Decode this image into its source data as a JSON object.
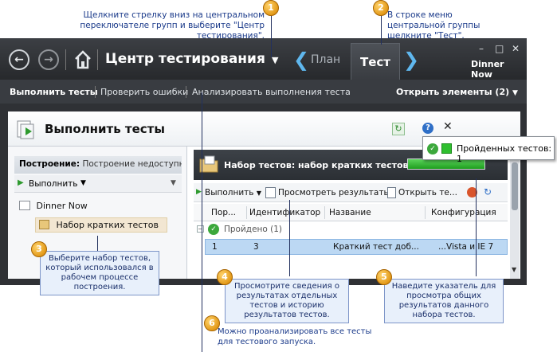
{
  "callouts": [
    {
      "num": "1",
      "text": "Щелкните стрелку вниз на центральном переключателе групп и выберите \"Центр тестирования\"."
    },
    {
      "num": "2",
      "text": "В строке меню центральной группы щелкните \"Тест\"."
    },
    {
      "num": "3",
      "text": "Выберите набор тестов, который использовался в рабочем процессе построения."
    },
    {
      "num": "4",
      "text": "Просмотрите сведения о результатах отдельных тестов и историю результатов тестов."
    },
    {
      "num": "5",
      "text": "Наведите указатель для просмотра общих результатов данного набора тестов."
    },
    {
      "num": "6",
      "text": "Можно проанализировать все тесты для тестового запуска."
    }
  ],
  "titlebar": {
    "title": "Центр тестирования",
    "tab_plan": "План",
    "tab_test": "Тест",
    "project": "Dinner Now",
    "minimize": "–",
    "restore": "□",
    "close": "✕"
  },
  "menubar": {
    "run_tests": "Выполнить тесты",
    "verify_bugs": "Проверить ошибки",
    "analyze_runs": "Анализировать выполнения теста",
    "open_items": "Открыть элементы (2)"
  },
  "page": {
    "title": "Выполнить тесты"
  },
  "left": {
    "build_label": "Построение:",
    "build_value": "Построение недоступно",
    "run_label": "Выполнить",
    "tree_root": "Dinner Now",
    "tree_child": "Набор кратких тестов"
  },
  "right": {
    "suite_title": "Набор тестов: набор кратких тестов",
    "toolbar": {
      "run": "Выполнить",
      "view_results": "Просмотреть результаты",
      "open_test": "Открыть те..."
    },
    "columns": [
      "Пор...",
      "Идентификатор",
      "Название",
      "Конфигурация"
    ],
    "group_label": "Пройдено (1)",
    "row": {
      "order": "1",
      "id": "3",
      "name": "Краткий тест доб...",
      "config": "...Vista и IE 7"
    }
  },
  "tooltip": {
    "text": "Пройденных тестов: 1"
  },
  "colors": {
    "accent": "#5fb7ee",
    "passed": "#3ca83c",
    "selected_row": "#bcd8f3",
    "callout_badge": "#e39a1a"
  }
}
